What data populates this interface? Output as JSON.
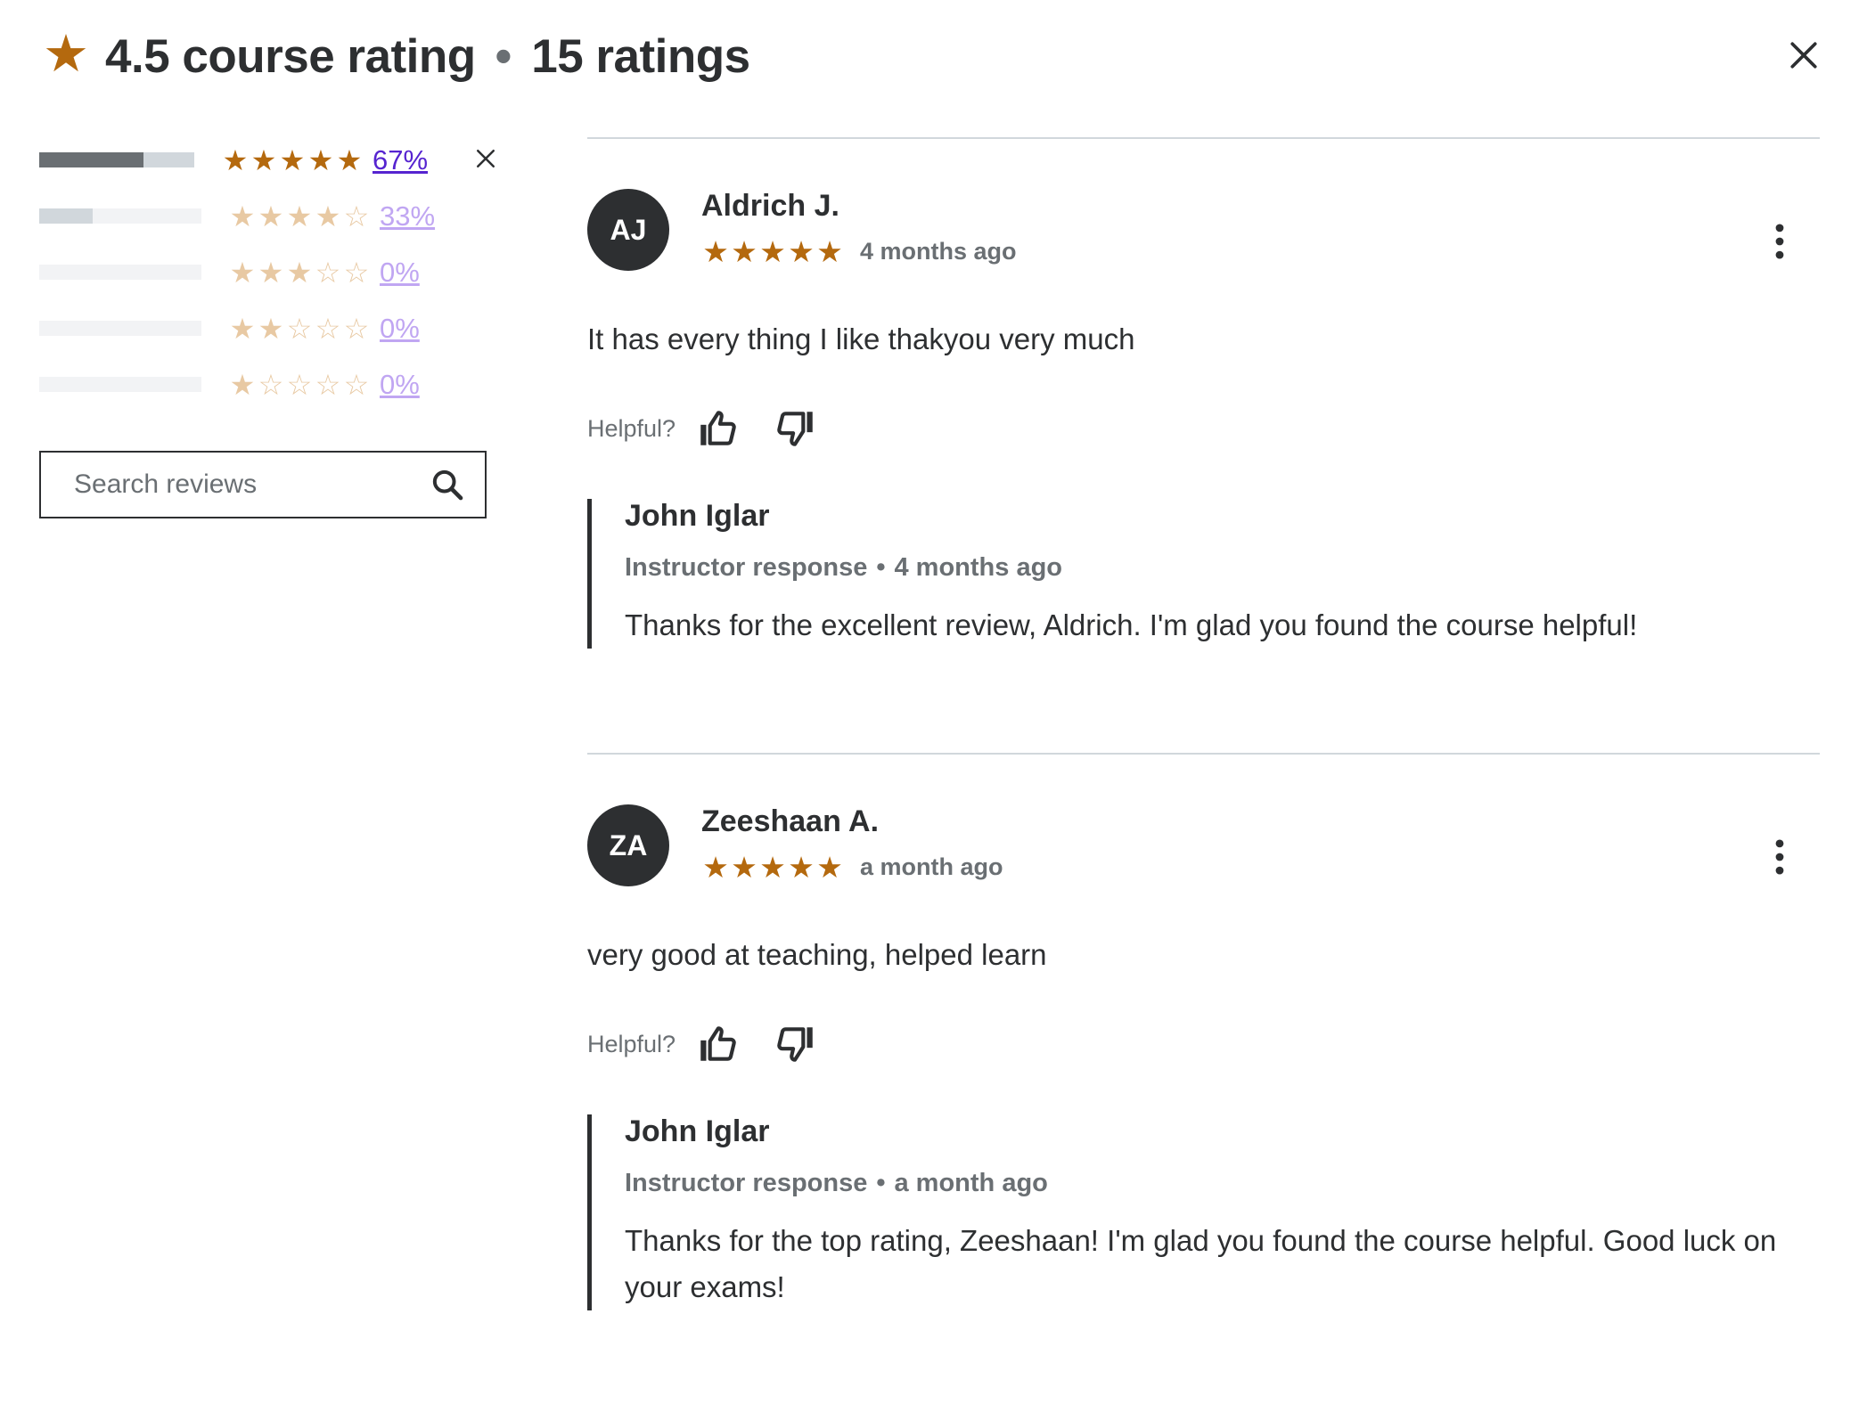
{
  "header": {
    "star_icon": "star-icon",
    "rating_text": "4.5 course rating",
    "separator": "•",
    "count_text": "15 ratings",
    "close_icon": "close-icon"
  },
  "distribution": [
    {
      "stars": 5,
      "percent_label": "67%",
      "percent_value": 67,
      "selected": true
    },
    {
      "stars": 4,
      "percent_label": "33%",
      "percent_value": 33,
      "selected": false
    },
    {
      "stars": 3,
      "percent_label": "0%",
      "percent_value": 0,
      "selected": false
    },
    {
      "stars": 2,
      "percent_label": "0%",
      "percent_value": 0,
      "selected": false
    },
    {
      "stars": 1,
      "percent_label": "0%",
      "percent_value": 0,
      "selected": false
    }
  ],
  "search": {
    "placeholder": "Search reviews",
    "value": "",
    "icon": "search-icon"
  },
  "reviews": [
    {
      "initials": "AJ",
      "name": "Aldrich J.",
      "rating": 5,
      "date": "4 months ago",
      "text": "It has every thing I like thakyou very much",
      "helpful_label": "Helpful?",
      "response": {
        "name": "John Iglar",
        "label": "Instructor response",
        "separator": "•",
        "date": "4 months ago",
        "text": "Thanks for the excellent review, Aldrich. I'm glad you found the course helpful!"
      }
    },
    {
      "initials": "ZA",
      "name": "Zeeshaan A.",
      "rating": 5,
      "date": "a month ago",
      "text": "very good at teaching, helped learn",
      "helpful_label": "Helpful?",
      "response": {
        "name": "John Iglar",
        "label": "Instructor response",
        "separator": "•",
        "date": "a month ago",
        "text": "Thanks for the top rating, Zeeshaan! I'm glad you found the course helpful. Good luck on your exams!"
      }
    }
  ],
  "colors": {
    "star": "#b4690e",
    "star_dim": "#e8c9a3",
    "link": "#5624d0",
    "link_dim": "#c0a6f2",
    "text": "#2d2f31",
    "muted": "#6a6f73"
  }
}
